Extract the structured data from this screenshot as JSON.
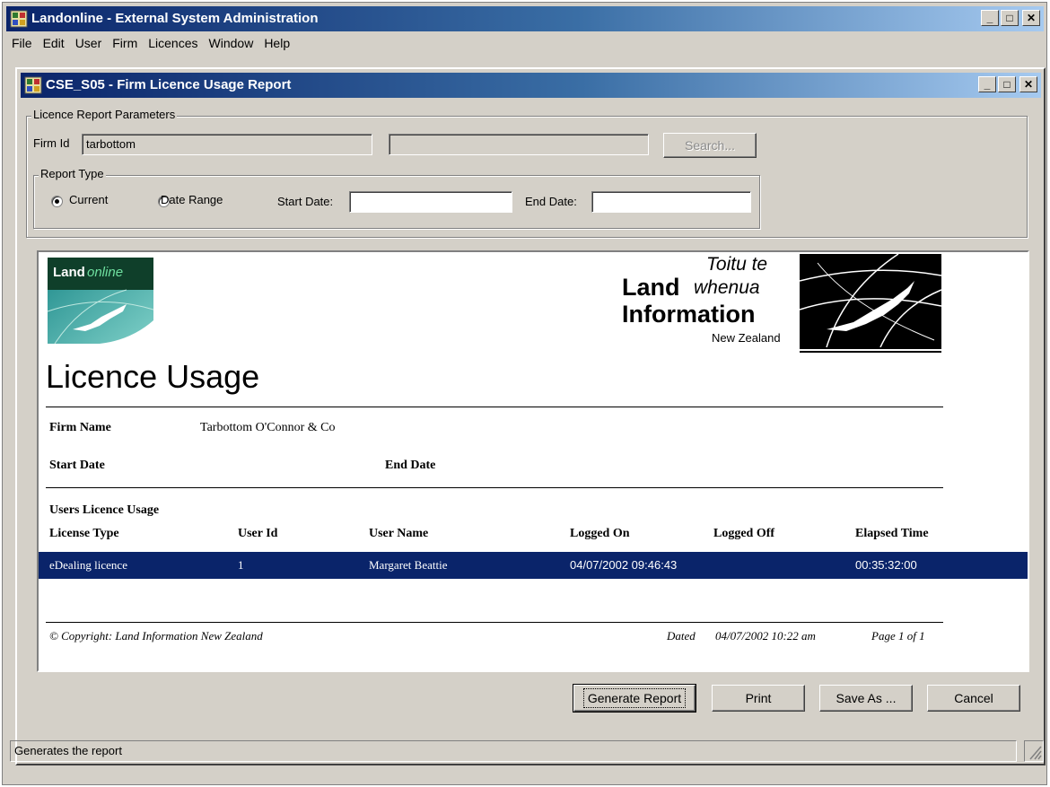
{
  "app": {
    "title": "Landonline - External System Administration",
    "menu": [
      "File",
      "Edit",
      "User",
      "Firm",
      "Licences",
      "Window",
      "Help"
    ]
  },
  "window": {
    "title": "CSE_S05 - Firm Licence Usage Report"
  },
  "params": {
    "group_label": "Licence Report Parameters",
    "firm_id_label": "Firm Id",
    "firm_id_value": "tarbottom",
    "firm_name_value": "",
    "search_label": "Search...",
    "report_type_label": "Report Type",
    "radio_current": "Current",
    "radio_date_range": "Date Range",
    "selected": "Current",
    "start_date_label": "Start Date:",
    "start_date_value": "",
    "end_date_label": "End Date:",
    "end_date_value": ""
  },
  "report": {
    "logo_left_text_a": "Land",
    "logo_left_text_b": "online",
    "logo_right": {
      "line1_italic": "Toitu te",
      "line2_bold": "Land",
      "line2_italic": "whenua",
      "line3_bold": "Information",
      "line4": "New Zealand"
    },
    "title": "Licence Usage",
    "firm_name_label": "Firm Name",
    "firm_name_value": "Tarbottom O'Connor & Co",
    "start_date_label": "Start Date",
    "end_date_label": "End Date",
    "section_title": "Users Licence Usage",
    "columns": [
      "License Type",
      "User Id",
      "User Name",
      "Logged On",
      "Logged Off",
      "Elapsed Time"
    ],
    "rows": [
      [
        "eDealing licence",
        "1",
        "Margaret Beattie",
        "04/07/2002 09:46:43",
        "",
        "00:35:32:00"
      ]
    ],
    "footer_copyright": "© Copyright: Land Information New Zealand",
    "footer_dated_label": "Dated",
    "footer_dated_value": "04/07/2002 10:22 am",
    "footer_page": "Page 1 of 1"
  },
  "buttons": {
    "generate": "Generate Report",
    "print": "Print",
    "save_as": "Save As ...",
    "cancel": "Cancel"
  },
  "status": {
    "text": "Generates the report"
  },
  "colors": {
    "title_active": "#0a246a",
    "selected_row": "#0a246a",
    "face": "#d4d0c8"
  }
}
